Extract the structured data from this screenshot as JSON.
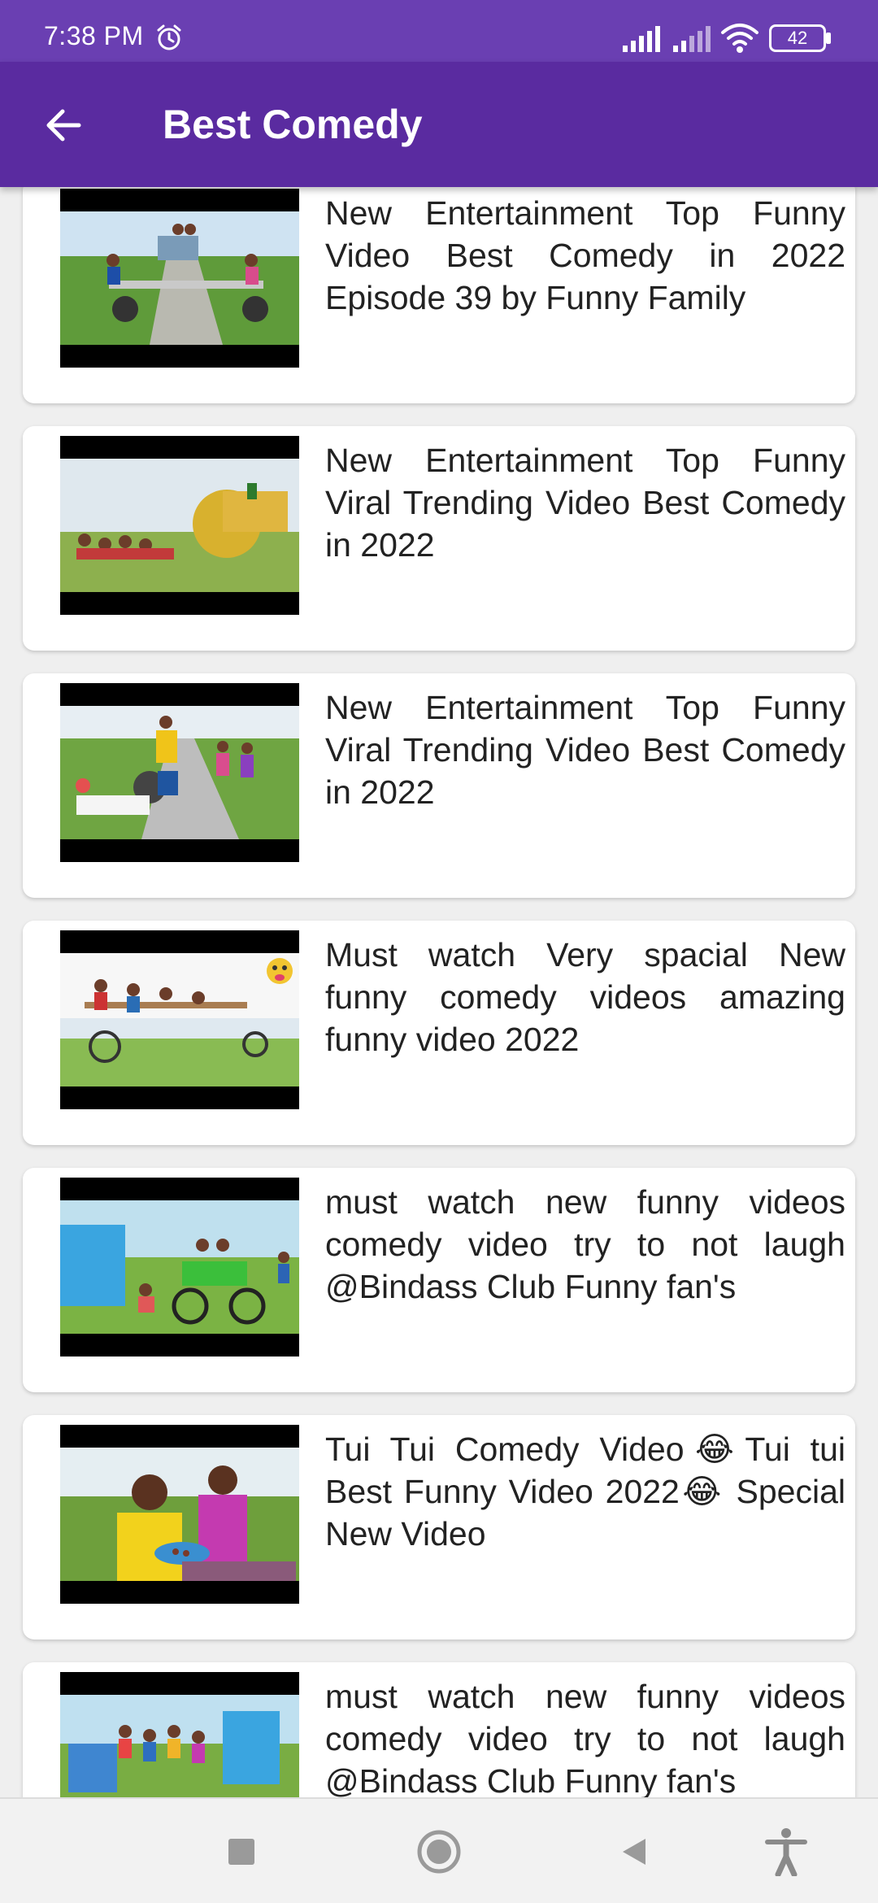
{
  "status": {
    "time": "7:38 PM",
    "battery": "42"
  },
  "header": {
    "title": "Best Comedy",
    "icons": {
      "back": "arrow-left-icon",
      "alarm": "alarm-clock-icon",
      "wifi": "wifi-icon",
      "signal": "cell-signal-icon",
      "battery": "battery-icon"
    }
  },
  "videos": [
    {
      "title": "New Entertainment Top Funny Video Best Comedy in 2022 Episode 39 by Funny Family"
    },
    {
      "title": "New Entertainment Top Funny Viral Trending Video Best Comedy in 2022"
    },
    {
      "title": "New Entertainment Top Funny Viral Trending Video Best Comedy in 2022"
    },
    {
      "title": "Must watch Very spacial New funny comedy videos amazing funny video 2022"
    },
    {
      "title": "must watch new funny videos comedy video try to not laugh @Bindass Club Funny fan's"
    },
    {
      "title": "Tui Tui Comedy Video😂Tui tui Best Funny Video 2022😂 Special New Video"
    },
    {
      "title": "must watch new funny videos comedy video try to not laugh @Bindass Club Funny fan's"
    }
  ],
  "nav": {
    "icons": [
      "recents-square-icon",
      "home-circle-icon",
      "back-triangle-icon",
      "accessibility-icon"
    ]
  },
  "colors": {
    "status_bar": "#6a3fb2",
    "app_bar": "#5a2ba0",
    "background": "#efefef",
    "card": "#ffffff",
    "text": "#222222"
  }
}
